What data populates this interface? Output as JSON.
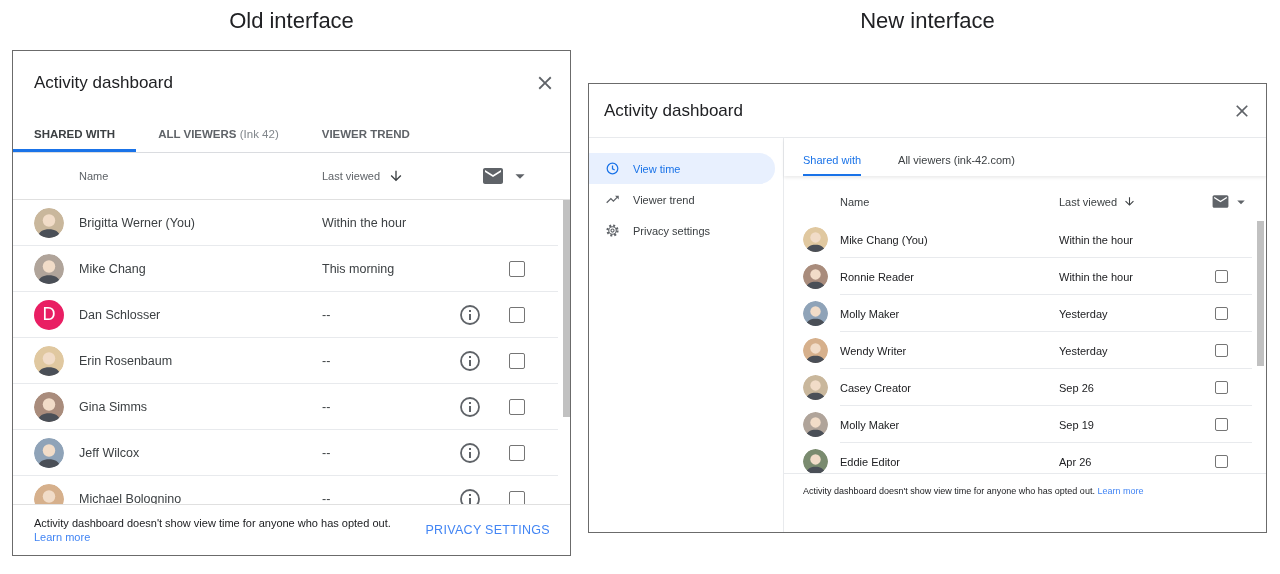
{
  "old_interface": {
    "caption": "Old interface",
    "title": "Activity dashboard",
    "tabs": [
      {
        "label": "SHARED WITH",
        "selected": true
      },
      {
        "label": "ALL VIEWERS",
        "note": "(Ink 42)",
        "selected": false
      },
      {
        "label": "VIEWER TREND",
        "selected": false
      }
    ],
    "columns": [
      "Name",
      "Last viewed"
    ],
    "rows": [
      {
        "name": "Brigitta Werner (You)",
        "last_viewed": "Within the hour",
        "avatar": {
          "kind": "photo"
        },
        "info": false
      },
      {
        "name": "Mike Chang",
        "last_viewed": "This morning",
        "avatar": {
          "kind": "photo"
        },
        "info": false,
        "checked": false
      },
      {
        "name": "Dan Schlosser",
        "last_viewed": "--",
        "avatar": {
          "kind": "letter",
          "letter": "D",
          "color": "#e91e63"
        },
        "info": true,
        "checked": false
      },
      {
        "name": "Erin Rosenbaum",
        "last_viewed": "--",
        "avatar": {
          "kind": "photo"
        },
        "info": true,
        "checked": false
      },
      {
        "name": "Gina Simms",
        "last_viewed": "--",
        "avatar": {
          "kind": "photo"
        },
        "info": true,
        "checked": false
      },
      {
        "name": "Jeff Wilcox",
        "last_viewed": "--",
        "avatar": {
          "kind": "photo"
        },
        "info": true,
        "checked": false
      },
      {
        "name": "Michael Bolognino",
        "last_viewed": "--",
        "avatar": {
          "kind": "photo"
        },
        "info": true,
        "checked": false
      }
    ],
    "notice": "Activity dashboard doesn't show view time for anyone who has opted out.",
    "link": "Learn more",
    "button": "PRIVACY SETTINGS"
  },
  "new_interface": {
    "caption": "New interface",
    "title": "Activity dashboard",
    "sidebar": [
      {
        "label": "View time",
        "selected": true
      },
      {
        "label": "Viewer trend",
        "selected": false
      },
      {
        "label": "Privacy settings",
        "selected": false
      }
    ],
    "tabs": [
      {
        "label": "Shared with",
        "selected": true
      },
      {
        "label": "All viewers (ink-42.com)",
        "selected": false
      }
    ],
    "columns": [
      "Name",
      "Last viewed"
    ],
    "rows": [
      {
        "name": "Mike Chang (You)",
        "last_viewed": "Within the hour",
        "avatar": {
          "kind": "photo"
        }
      },
      {
        "name": "Ronnie Reader",
        "last_viewed": "Within the hour",
        "avatar": {
          "kind": "photo"
        },
        "checked": false
      },
      {
        "name": "Molly Maker",
        "last_viewed": "Yesterday",
        "avatar": {
          "kind": "photo"
        },
        "checked": false
      },
      {
        "name": "Wendy Writer",
        "last_viewed": "Yesterday",
        "avatar": {
          "kind": "photo"
        },
        "checked": false
      },
      {
        "name": "Casey Creator",
        "last_viewed": "Sep 26",
        "avatar": {
          "kind": "photo"
        },
        "checked": false
      },
      {
        "name": "Molly Maker",
        "last_viewed": "Sep 19",
        "avatar": {
          "kind": "photo"
        },
        "checked": false
      },
      {
        "name": "Eddie Editor",
        "last_viewed": "Apr 26",
        "avatar": {
          "kind": "photo"
        },
        "checked": false
      }
    ],
    "notice": "Activity dashboard doesn't show view time for anyone who has opted out.",
    "link": "Learn more"
  }
}
